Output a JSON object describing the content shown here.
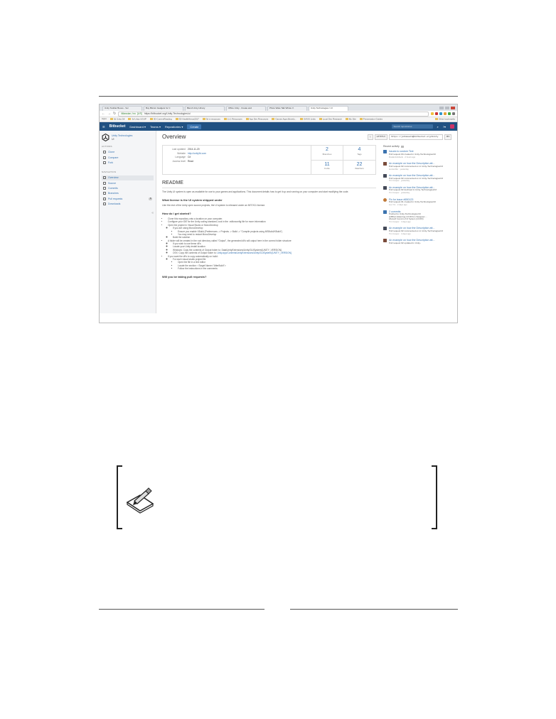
{
  "browser": {
    "tabs": [
      "Unity Toolbar Boxes - Ver",
      "Buy Bitcoin Gadgets for C",
      "Blend Unity Library",
      "Office Unity - Create and",
      "Photo Wate Talk Whole V.",
      "Unity Technologies / UI"
    ],
    "active_tab": 5,
    "url": "https://bitbucket.org/Unity-Technologies/ui",
    "url_secure_label": "Atlassian, Inc. [US]",
    "bookmarks": [
      "Apps",
      "3d Unity Dif",
      "3d Unity UGUP",
      "3D CurrentReading",
      "3D HealthHeros2017",
      "3d tr resources",
      "11.1 Resources",
      "App Dev Resources",
      "Games Apps Bevelo...",
      "GAVIS Links",
      "Local Dev Research",
      "My Site",
      "Presentation Guides",
      "Other bookmarks"
    ]
  },
  "bitbucket": {
    "logo": "Bitbucket",
    "nav": [
      "Dashboard ▾",
      "Teams ▾",
      "Repositories ▾"
    ],
    "create": "Create",
    "search_placeholder": "Search repositories"
  },
  "sidebar": {
    "repo_name": "Unity Technologies",
    "repo_slug": "UI",
    "actions_title": "ACTIONS",
    "actions": [
      "Clone",
      "Compare",
      "Fork"
    ],
    "navigation_title": "NAVIGATION",
    "nav": [
      "Overview",
      "Source",
      "Commits",
      "Branches",
      "Pull requests",
      "Downloads"
    ],
    "pull_requests_count": "8",
    "collapse": "«"
  },
  "main": {
    "title": "Overview",
    "clone_protocol": "HTTPS ▾",
    "clone_url": "https://johnmearm@bitbucket.org/Unity",
    "info": {
      "last_updated_label": "Last updated",
      "last_updated": "2014-11-20",
      "website_label": "Website",
      "website": "http://unity3d.com",
      "language_label": "Language",
      "language": "C#",
      "access_label": "Access level",
      "access": "Read"
    },
    "stats": [
      {
        "num": "2",
        "label": "Branches"
      },
      {
        "num": "4",
        "label": "Tags"
      },
      {
        "num": "11",
        "label": "Forks"
      },
      {
        "num": "22",
        "label": "Watchers"
      }
    ],
    "readme_title": "README",
    "readme_intro": "The Unity UI system is open as available for use to your games and applications. This document details how to get it up and running on your computer and start modifying the code.",
    "h_license": "What license is the UI system shipped under",
    "license_text": "Like the rest of the Unity open source projects, the UI system is released under an MIT/X11 license.",
    "h_start": "How do I get started?",
    "steps": {
      "s1": "Clone this repository onto a location on your computer.",
      "s2": "Configure your IDE for the Unity coding standard, look in the .editorconfig file for more information",
      "s3": "Open the project in Visual Studio or MonoDevelop",
      "s3a": "If you are using MonoDevelop",
      "s3a1": "Ensure you enable XBuild (Preferences -> Projects -> Build -> \"Compile projects using MSBuild/XBuild\")",
      "s3a2": "You may need to restart MonoDevelop",
      "s3b": "Build the solution",
      "s4": "A folder will be created in the root directory called \"Output\", the generated dll's will output here in the correct folder structure",
      "s4a": "If you wish to use these dll's",
      "s4b": "Locate your Unity install location",
      "s4c": "Windows: Copy the contents of Output folder to: Data\\UnityExtensions\\Unity\\GUISystem\\{UNITY_VERSION}",
      "s4d_prefix": "OSX: Copy the contents of Output folder to:",
      "s4d_link": "Unity.app/Contents/UnityExtensions/Unity/GUISystem/{UNITY_VERSION}",
      "s5": "If you want the dll's to copy automatically on build:",
      "s5a": "For each visual studio project file",
      "s5a1": "Open the file in a text editor",
      "s5a2": "Locate the section: <Target Name=\"AfterBuild\">",
      "s5a3": "Follow the instructions in the comments"
    },
    "h_pull": "Will you be taking pull requests?"
  },
  "activity": {
    "title": "Recent activity",
    "items": [
      {
        "title": "Issues to custom Text",
        "desc": "Pull request #4 created in Unity-Technologies/UI",
        "meta": "RuslanGrishenk · 2 hours ago",
        "color": "#3b73af"
      },
      {
        "title": "An example on how the Description att...",
        "desc": "Pull request #2 commented on in Unity-Technologies/UI",
        "meta": "leonsroffer · yesterday",
        "color": "#7a4b3a"
      },
      {
        "title": "An example on how the Description att...",
        "desc": "Pull request #2 commented on in Unity-Technologies/UI",
        "meta": "Tim Cooper · yesterday",
        "color": "#444a58"
      },
      {
        "title": "An example on how the Description att...",
        "desc": "Pull request #2 declined in Unity-Technologies/UI",
        "meta": "Tim Cooper · yesterday",
        "color": "#444a58"
      },
      {
        "title": "Fix for issue #650123",
        "desc": "Pull request #1 created in Unity-Technologies/UI",
        "meta": "Luo Yin · 2 days ago",
        "color": "#c07a3a"
      },
      {
        "title": "2 commits",
        "desc": "Pushed to Unity-Technologies/UI",
        "commit1": "ac8f6e1 Added tag 4.6.0f3 for changeset ...",
        "commit2": "18e1e2f Commit of UI System (4.6.0f3)",
        "meta": "Tim Cooper · 4 days ago",
        "color": "#3b73af"
      },
      {
        "title": "An example on how the Description att...",
        "desc": "Pull request #2 commented on in Unity-Technologies/UI",
        "meta": "Tim Cooper · 4 days ago",
        "color": "#444a58"
      },
      {
        "title": "An example on how the Description att...",
        "desc": "Pull request #2 updated in Unity-",
        "meta": "",
        "color": "#7a4b3a"
      }
    ]
  }
}
